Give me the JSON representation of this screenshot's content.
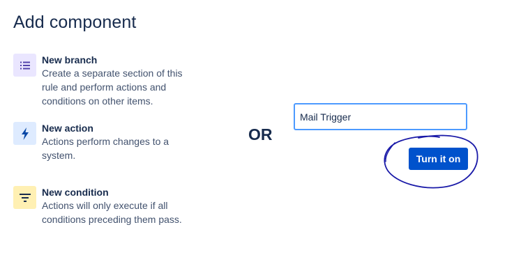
{
  "header": {
    "title": "Add component"
  },
  "options": [
    {
      "title": "New branch",
      "description": "Create a separate section of this rule and perform actions and conditions on other items.",
      "icon": "list-icon",
      "icon_bg": "#eae6ff",
      "icon_color": "#5243aa"
    },
    {
      "title": "New action",
      "description": "Actions perform changes to a system.",
      "icon": "lightning-bolt-icon",
      "icon_bg": "#deebff",
      "icon_color": "#0747a6"
    },
    {
      "title": "New condition",
      "description": "Actions will only execute if all conditions preceding them pass.",
      "icon": "filter-icon",
      "icon_bg": "#fff0b3",
      "icon_color": "#172b4d"
    }
  ],
  "divider_text": "OR",
  "name_input": {
    "value": "Mail Trigger"
  },
  "primary_button": {
    "label": "Turn it on",
    "color": "#0052cc"
  },
  "annotation": {
    "color": "#1a1aa8"
  }
}
